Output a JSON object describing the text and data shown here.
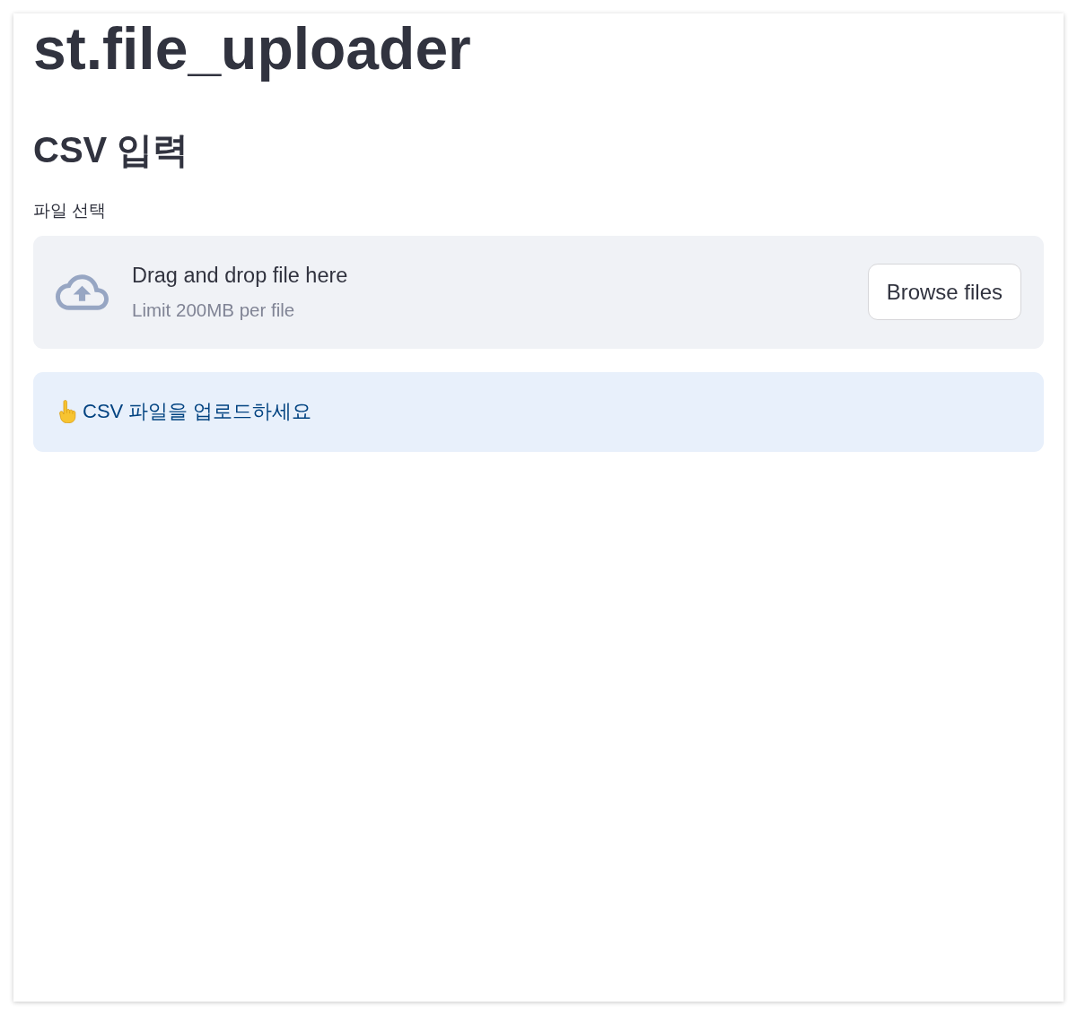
{
  "title": "st.file_uploader",
  "subheader": "CSV 입력",
  "uploader": {
    "label": "파일 선택",
    "instruction": "Drag and drop file here",
    "limit": "Limit 200MB per file",
    "button": "Browse files"
  },
  "alert": {
    "kind": "info",
    "message": "CSV 파일을 업로드하세요"
  }
}
